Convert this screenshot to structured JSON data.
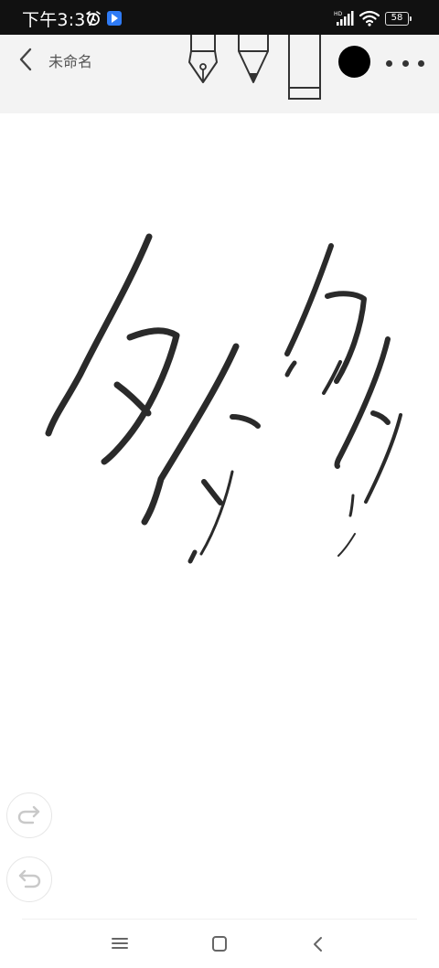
{
  "status_bar": {
    "time": "下午3:37",
    "battery": "58",
    "icons": [
      "alarm-icon",
      "app-notification-icon",
      "hd-signal-icon",
      "wifi-icon",
      "battery-icon"
    ]
  },
  "toolbar": {
    "title": "未命名",
    "tools": [
      "fountain-pen",
      "marker-pen",
      "eraser"
    ],
    "current_color": "#000000"
  },
  "canvas": {
    "background": "#ffffff",
    "ink_color": "#2a2a2a"
  },
  "side_buttons": [
    "redo",
    "undo"
  ],
  "nav_bar": [
    "menu",
    "home",
    "back"
  ]
}
